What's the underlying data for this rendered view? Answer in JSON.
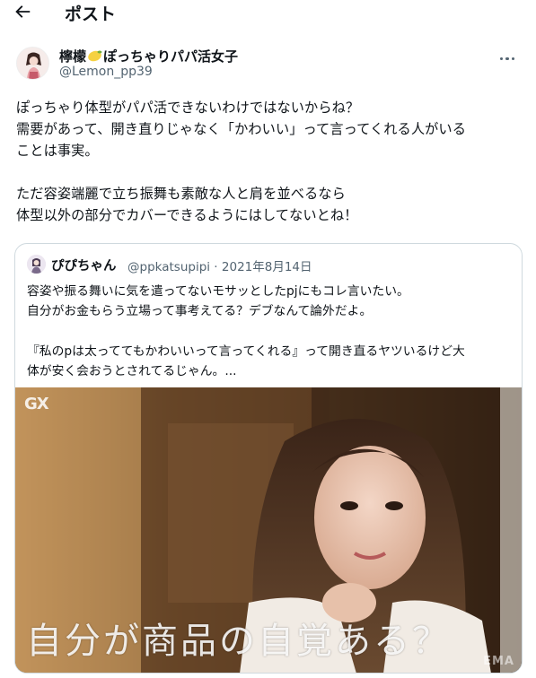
{
  "header": {
    "title": "ポスト"
  },
  "author": {
    "display_name_before": "檸檬",
    "display_name_after": "ぽっちゃりパパ活女子",
    "handle": "@Lemon_pp39"
  },
  "tweet": {
    "text": "ぽっちゃり体型がパパ活できないわけではないからね？\n需要があって、開き直りじゃなく「かわいい」って言ってくれる人がいる\nことは事実。\n\nただ容姿端麗で立ち振舞も素敵な人と肩を並べるなら\n体型以外の部分でカバーできるようにはしてないとね！"
  },
  "quote": {
    "name": "ぴぴちゃん",
    "meta": "@ppkatsupipi · 2021年8月14日",
    "text": "容姿や振る舞いに気を遣ってないモサッとしたpjにもコレ言いたい。\n自分がお金もらう立場って事考えてる？デブなんて論外だよ。\n\n『私のpは太っててもかわいいって言ってくれる』って開き直るヤツいるけど大\n体が安く会おうとされてるじゃん。...",
    "media": {
      "logo": "GX",
      "subtitle": "自分が商品の自覚ある？",
      "watermark": "EMA"
    }
  },
  "icons": {
    "back": "back-arrow-icon",
    "more": "more-options-icon",
    "lemon": "lemon-emoji-icon"
  },
  "colors": {
    "text": "#0f1419",
    "secondary": "#536471",
    "border": "#cfd9de"
  }
}
